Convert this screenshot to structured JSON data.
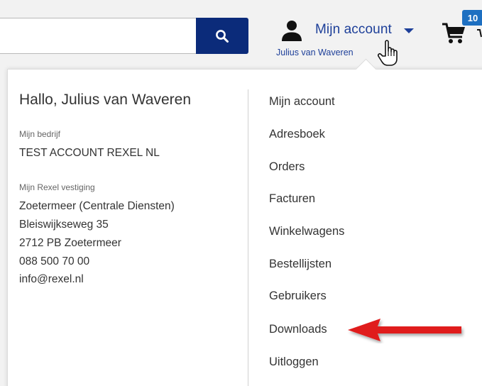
{
  "search": {
    "value": "",
    "placeholder": ""
  },
  "account": {
    "label": "Mijn account",
    "username": "Julius van Waveren"
  },
  "cart": {
    "count": "10"
  },
  "profile": {
    "greeting": "Hallo, Julius van Waveren",
    "company_label": "Mijn bedrijf",
    "company_name": "TEST ACCOUNT REXEL NL",
    "branch_label": "Mijn Rexel vestiging",
    "branch_name": "Zoetermeer (Centrale Diensten)",
    "branch_street": "Bleiswijkseweg 35",
    "branch_city": "2712 PB Zoetermeer",
    "branch_phone": "088 500 70 00",
    "branch_email": "info@rexel.nl"
  },
  "menu": {
    "items": [
      {
        "label": "Mijn account"
      },
      {
        "label": "Adresboek"
      },
      {
        "label": "Orders"
      },
      {
        "label": "Facturen"
      },
      {
        "label": "Winkelwagens"
      },
      {
        "label": "Bestellijsten"
      },
      {
        "label": "Gebruikers"
      },
      {
        "label": "Downloads"
      },
      {
        "label": "Uitloggen"
      }
    ]
  },
  "colors": {
    "brand_blue": "#0b2b7a",
    "link_blue": "#1d3f99",
    "badge_blue": "#1d6fc1",
    "annotation_red": "#e01c1c"
  },
  "icons": {
    "search": "magnifier-icon",
    "account": "person-icon",
    "caret": "caret-down-icon",
    "cursor": "hand-cursor-icon",
    "cart": "cart-icon",
    "annotation": "red-arrow-icon"
  }
}
